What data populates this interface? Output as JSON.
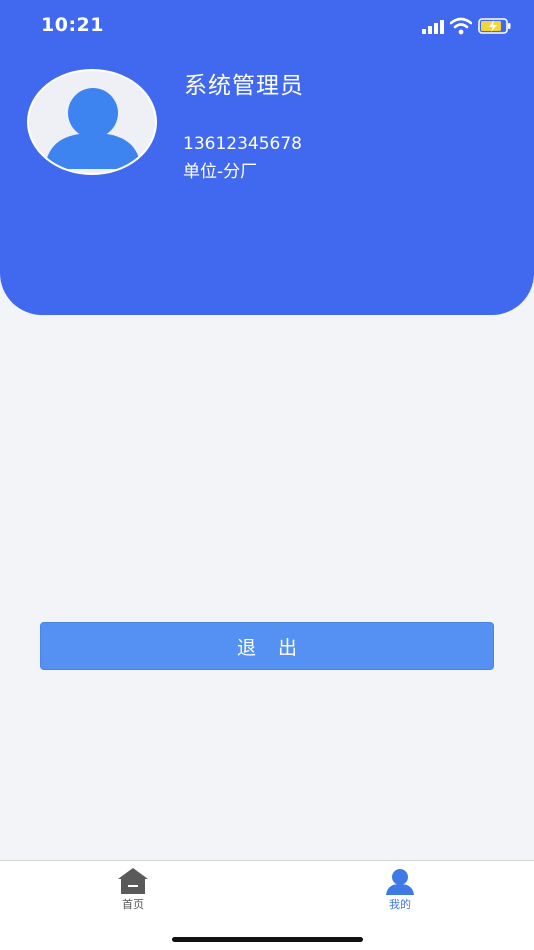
{
  "status_bar": {
    "time": "10:21",
    "icons": [
      "signal-icon",
      "wifi-icon",
      "battery-charging-icon"
    ]
  },
  "profile": {
    "name": "系统管理员",
    "phone": "13612345678",
    "unit": "单位-分厂",
    "avatar_icon": "user-avatar-icon"
  },
  "actions": {
    "logout_label": "退出"
  },
  "tab_bar": {
    "items": [
      {
        "label": "首页",
        "icon": "home-icon",
        "active": false
      },
      {
        "label": "我的",
        "icon": "user-icon",
        "active": true
      }
    ]
  },
  "colors": {
    "header_bg": "#4169f0",
    "page_bg": "#f3f4f7",
    "button_bg": "#5591f3",
    "active_tab": "#3f79e6",
    "inactive_tab": "#555555"
  }
}
